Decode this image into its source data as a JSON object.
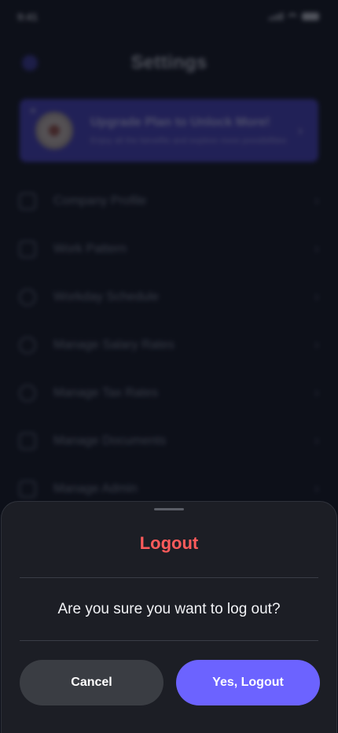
{
  "status_bar": {
    "time": "9:41"
  },
  "header": {
    "title": "Settings"
  },
  "upgrade_banner": {
    "close_icon": "close-icon",
    "title": "Upgrade Plan to Unlock More!",
    "subtitle": "Enjoy all the benefits and explore more possibilities",
    "chevron": "›"
  },
  "menu": {
    "chevron": "›",
    "items": [
      {
        "label": "Company Profile",
        "icon": "building-icon"
      },
      {
        "label": "Work Pattern",
        "icon": "grid-icon"
      },
      {
        "label": "Workday Schedule",
        "icon": "clock-icon"
      },
      {
        "label": "Manage Salary Rates",
        "icon": "dollar-icon"
      },
      {
        "label": "Manage Tax Rates",
        "icon": "percent-icon"
      },
      {
        "label": "Manage Documents",
        "icon": "document-icon"
      },
      {
        "label": "Manage Admin",
        "icon": "admin-icon"
      }
    ]
  },
  "dialog": {
    "title": "Logout",
    "message": "Are you sure you want to log out?",
    "cancel_label": "Cancel",
    "confirm_label": "Yes, Logout"
  },
  "colors": {
    "accent": "#6C63FF",
    "danger": "#FF5B5B",
    "sheet_background": "#1C1E25",
    "cancel_button": "#3A3D43"
  }
}
